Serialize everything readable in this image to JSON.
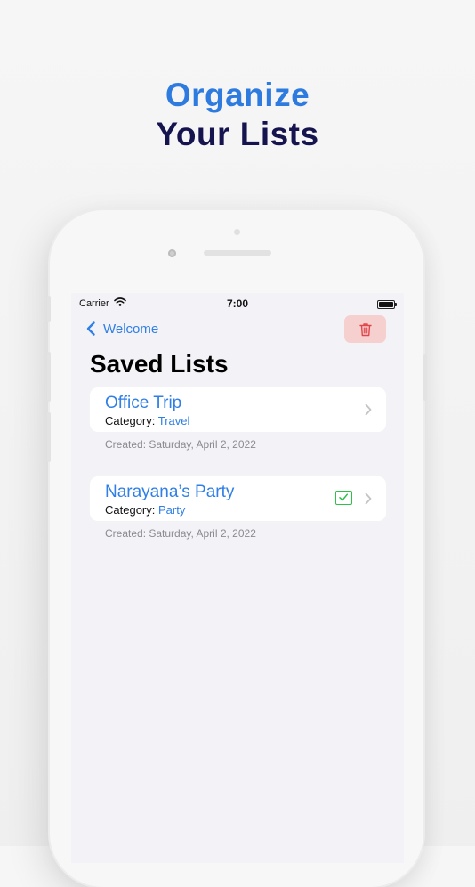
{
  "headline": {
    "line1": "Organize",
    "line2": "Your Lists"
  },
  "status_bar": {
    "carrier": "Carrier",
    "time": "7:00"
  },
  "nav": {
    "back_label": "Welcome"
  },
  "page_title": "Saved Lists",
  "lists": [
    {
      "name": "Office Trip",
      "category_label": "Category:",
      "category": "Travel",
      "created": "Created: Saturday, April 2, 2022",
      "completed": false
    },
    {
      "name": "Narayana’s Party",
      "category_label": "Category:",
      "category": "Party",
      "created": "Created: Saturday, April 2, 2022",
      "completed": true
    }
  ],
  "colors": {
    "accent": "#2f7fe6",
    "headline_blue": "#2e7be0",
    "headline_dark": "#16144f",
    "delete_bg": "#f6cfcf",
    "delete_icon": "#e0454a",
    "check": "#2fbf4a"
  }
}
